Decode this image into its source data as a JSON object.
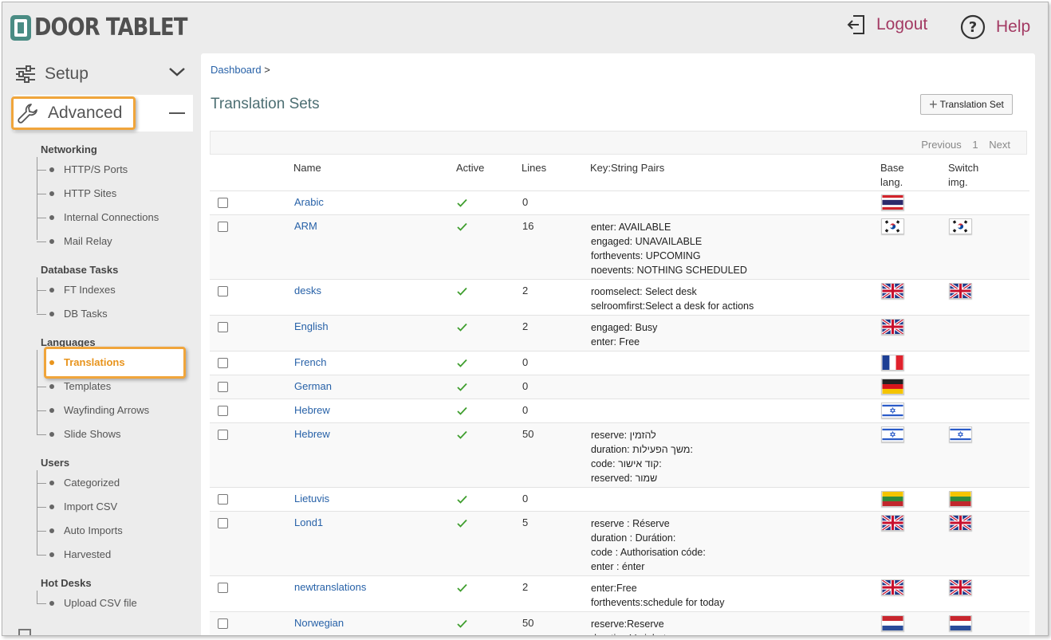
{
  "header": {
    "logo_text": "DOOR TABLET",
    "logout_label": "Logout",
    "help_label": "Help"
  },
  "sidebar": {
    "setup_label": "Setup",
    "advanced_label": "Advanced",
    "groups": [
      {
        "title": "Networking",
        "items": [
          "HTTP/S Ports",
          "HTTP Sites",
          "Internal Connections",
          "Mail Relay"
        ]
      },
      {
        "title": "Database Tasks",
        "items": [
          "FT Indexes",
          "DB Tasks"
        ]
      },
      {
        "title": "Languages",
        "items": [
          "Translations",
          "Templates",
          "Wayfinding Arrows",
          "Slide Shows"
        ]
      },
      {
        "title": "Users",
        "items": [
          "Categorized",
          "Import CSV",
          "Auto Imports",
          "Harvested"
        ]
      },
      {
        "title": "Hot Desks",
        "items": [
          "Upload CSV file"
        ]
      }
    ],
    "active_item": "Translations"
  },
  "main": {
    "breadcrumb_link": "Dashboard",
    "breadcrumb_sep": ">",
    "title": "Translation Sets",
    "add_button": "Translation Set",
    "pager": {
      "previous": "Previous",
      "page": "1",
      "next": "Next"
    },
    "columns": {
      "name": "Name",
      "active": "Active",
      "lines": "Lines",
      "kv": "Key:String Pairs",
      "base_1": "Base",
      "base_2": "lang.",
      "switch_1": "Switch",
      "switch_2": "img."
    },
    "rows": [
      {
        "name": "Arabic",
        "lines": "0",
        "kv": [],
        "base": "thai",
        "switch": ""
      },
      {
        "name": "ARM",
        "lines": "16",
        "kv": [
          "enter: AVAILABLE",
          "engaged: UNAVAILABLE",
          "forthevents: UPCOMING",
          "noevents: NOTHING SCHEDULED"
        ],
        "base": "korea",
        "switch": "korea"
      },
      {
        "name": "desks",
        "lines": "2",
        "kv": [
          "roomselect: Select desk",
          "selroomfirst:Select a desk for actions"
        ],
        "base": "uk",
        "switch": "uk"
      },
      {
        "name": "English",
        "lines": "2",
        "kv": [
          "engaged: Busy",
          "enter: Free"
        ],
        "base": "uk",
        "switch": ""
      },
      {
        "name": "French",
        "lines": "0",
        "kv": [],
        "base": "france",
        "switch": ""
      },
      {
        "name": "German",
        "lines": "0",
        "kv": [],
        "base": "germany",
        "switch": ""
      },
      {
        "name": "Hebrew",
        "lines": "0",
        "kv": [],
        "base": "israel",
        "switch": ""
      },
      {
        "name": "Hebrew",
        "lines": "50",
        "kv": [
          "reserve: להזמין",
          "duration: משך הפעילות:",
          "code: קוד אישור:",
          "reserved: שמור"
        ],
        "base": "israel",
        "switch": "israel"
      },
      {
        "name": "Lietuvis",
        "lines": "0",
        "kv": [],
        "base": "lithuania",
        "switch": "lithuania"
      },
      {
        "name": "Lond1",
        "lines": "5",
        "kv": [
          "reserve : Réserve",
          "duration : Durátion:",
          "code : Authorisation códe:",
          "enter : énter"
        ],
        "base": "uk",
        "switch": "uk"
      },
      {
        "name": "newtranslations",
        "lines": "2",
        "kv": [
          "enter:Free",
          "forthevents:schedule for today"
        ],
        "base": "uk",
        "switch": "uk"
      },
      {
        "name": "Norwegian",
        "lines": "50",
        "kv": [
          "reserve:Reserve",
          "duration:Varighet :"
        ],
        "base": "netherlands",
        "switch": "netherlands"
      }
    ]
  }
}
